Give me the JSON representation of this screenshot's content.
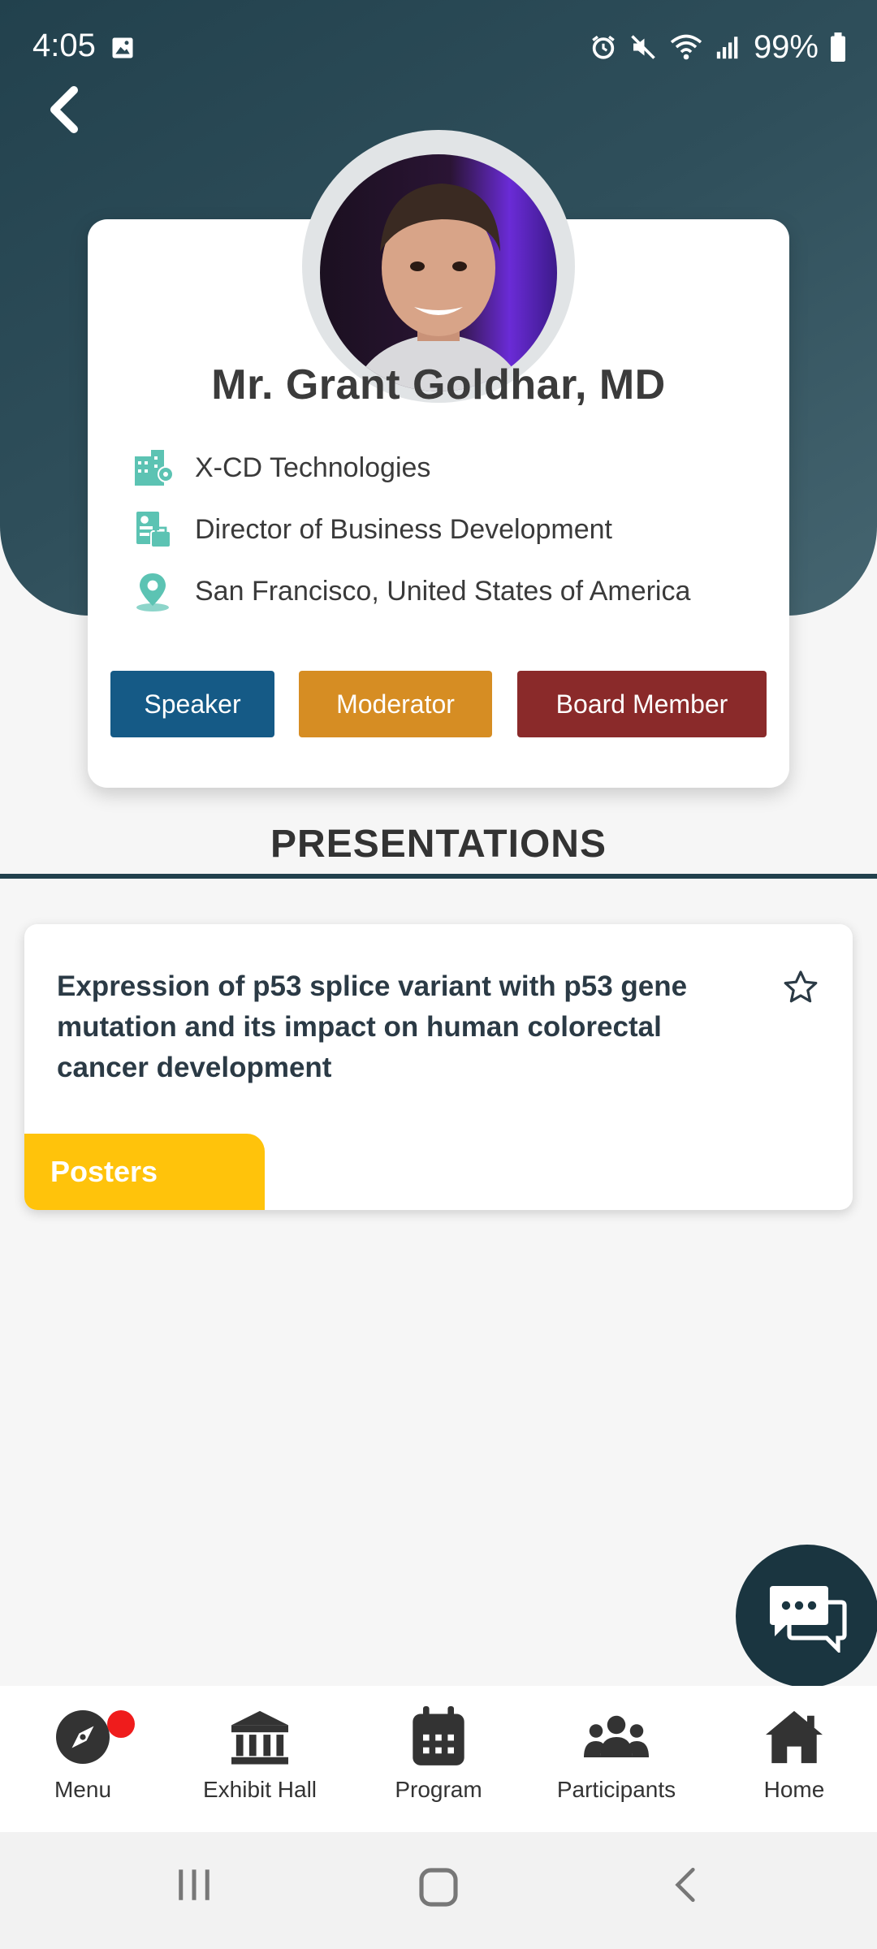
{
  "status_bar": {
    "time": "4:05",
    "battery": "99%",
    "icons": [
      "image-icon",
      "alarm-icon",
      "mute-icon",
      "wifi-icon",
      "signal-icon",
      "battery-icon"
    ]
  },
  "profile": {
    "name": "Mr. Grant Goldhar, MD",
    "company": "X-CD Technologies",
    "title": "Director of Business Development",
    "location": "San Francisco, United States of America",
    "roles": [
      {
        "label": "Speaker",
        "color": "#155a86"
      },
      {
        "label": "Moderator",
        "color": "#d68d23"
      },
      {
        "label": "Board Member",
        "color": "#8a2a2a"
      }
    ]
  },
  "presentations": {
    "heading": "PRESENTATIONS",
    "items": [
      {
        "title": "Expression of p53 splice variant with p53 gene mutation and its impact on human colorectal cancer development",
        "tag": "Posters",
        "tag_color": "#ffc30b"
      }
    ]
  },
  "bottom_nav": {
    "items": [
      {
        "label": "Menu",
        "icon": "compass-icon",
        "badge": true
      },
      {
        "label": "Exhibit Hall",
        "icon": "building-icon"
      },
      {
        "label": "Program",
        "icon": "calendar-icon"
      },
      {
        "label": "Participants",
        "icon": "people-icon"
      },
      {
        "label": "Home",
        "icon": "home-icon"
      }
    ]
  },
  "colors": {
    "header": "#22414d",
    "accent_teal": "#5cc3b3",
    "chat_fab": "#1a3540",
    "badge_red": "#ef1c1c"
  }
}
